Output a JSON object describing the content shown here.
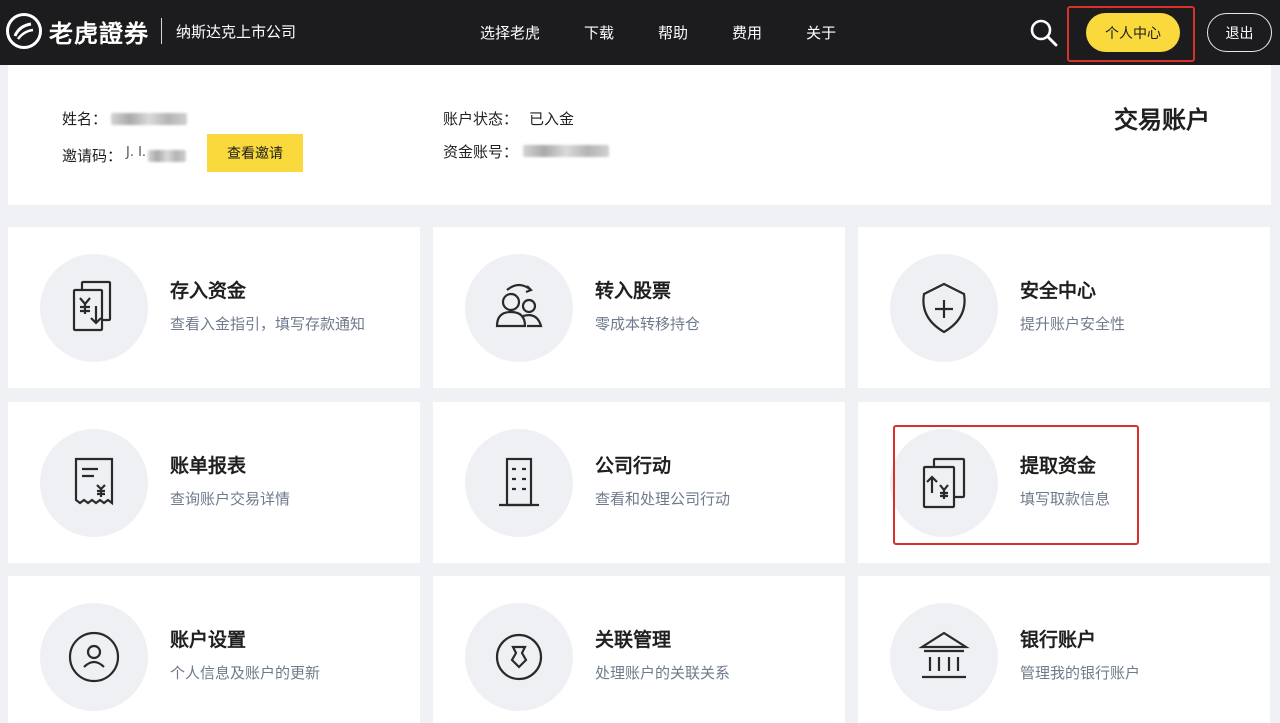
{
  "header": {
    "brand": "老虎證券",
    "tagline": "纳斯达克上市公司",
    "nav": [
      "选择老虎",
      "下载",
      "帮助",
      "费用",
      "关于"
    ],
    "personal_center": "个人中心",
    "logout": "退出"
  },
  "account": {
    "name_label": "姓名：",
    "invite_label": "邀请码：",
    "invite_code_partial": "J. I.",
    "view_invite_button": "查看邀请",
    "status_label": "账户状态：",
    "status_value": "已入金",
    "fund_account_label": "资金账号：",
    "title": "交易账户"
  },
  "cards": [
    {
      "title": "存入资金",
      "desc": "查看入金指引，填写存款通知",
      "icon": "deposit-icon"
    },
    {
      "title": "转入股票",
      "desc": "零成本转移持仓",
      "icon": "users-transfer-icon"
    },
    {
      "title": "安全中心",
      "desc": "提升账户安全性",
      "icon": "shield-plus-icon"
    },
    {
      "title": "账单报表",
      "desc": "查询账户交易详情",
      "icon": "receipt-icon"
    },
    {
      "title": "公司行动",
      "desc": "查看和处理公司行动",
      "icon": "building-icon"
    },
    {
      "title": "提取资金",
      "desc": "填写取款信息",
      "icon": "withdraw-icon"
    },
    {
      "title": "账户设置",
      "desc": "个人信息及账户的更新",
      "icon": "user-circle-icon"
    },
    {
      "title": "关联管理",
      "desc": "处理账户的关联关系",
      "icon": "link-management-icon"
    },
    {
      "title": "银行账户",
      "desc": "管理我的银行账户",
      "icon": "bank-icon"
    }
  ],
  "colors": {
    "accent_yellow": "#f9d93c",
    "header_bg": "#1c1c1e",
    "highlight_red": "#d7312a",
    "desc_text": "#6f7a8c"
  }
}
